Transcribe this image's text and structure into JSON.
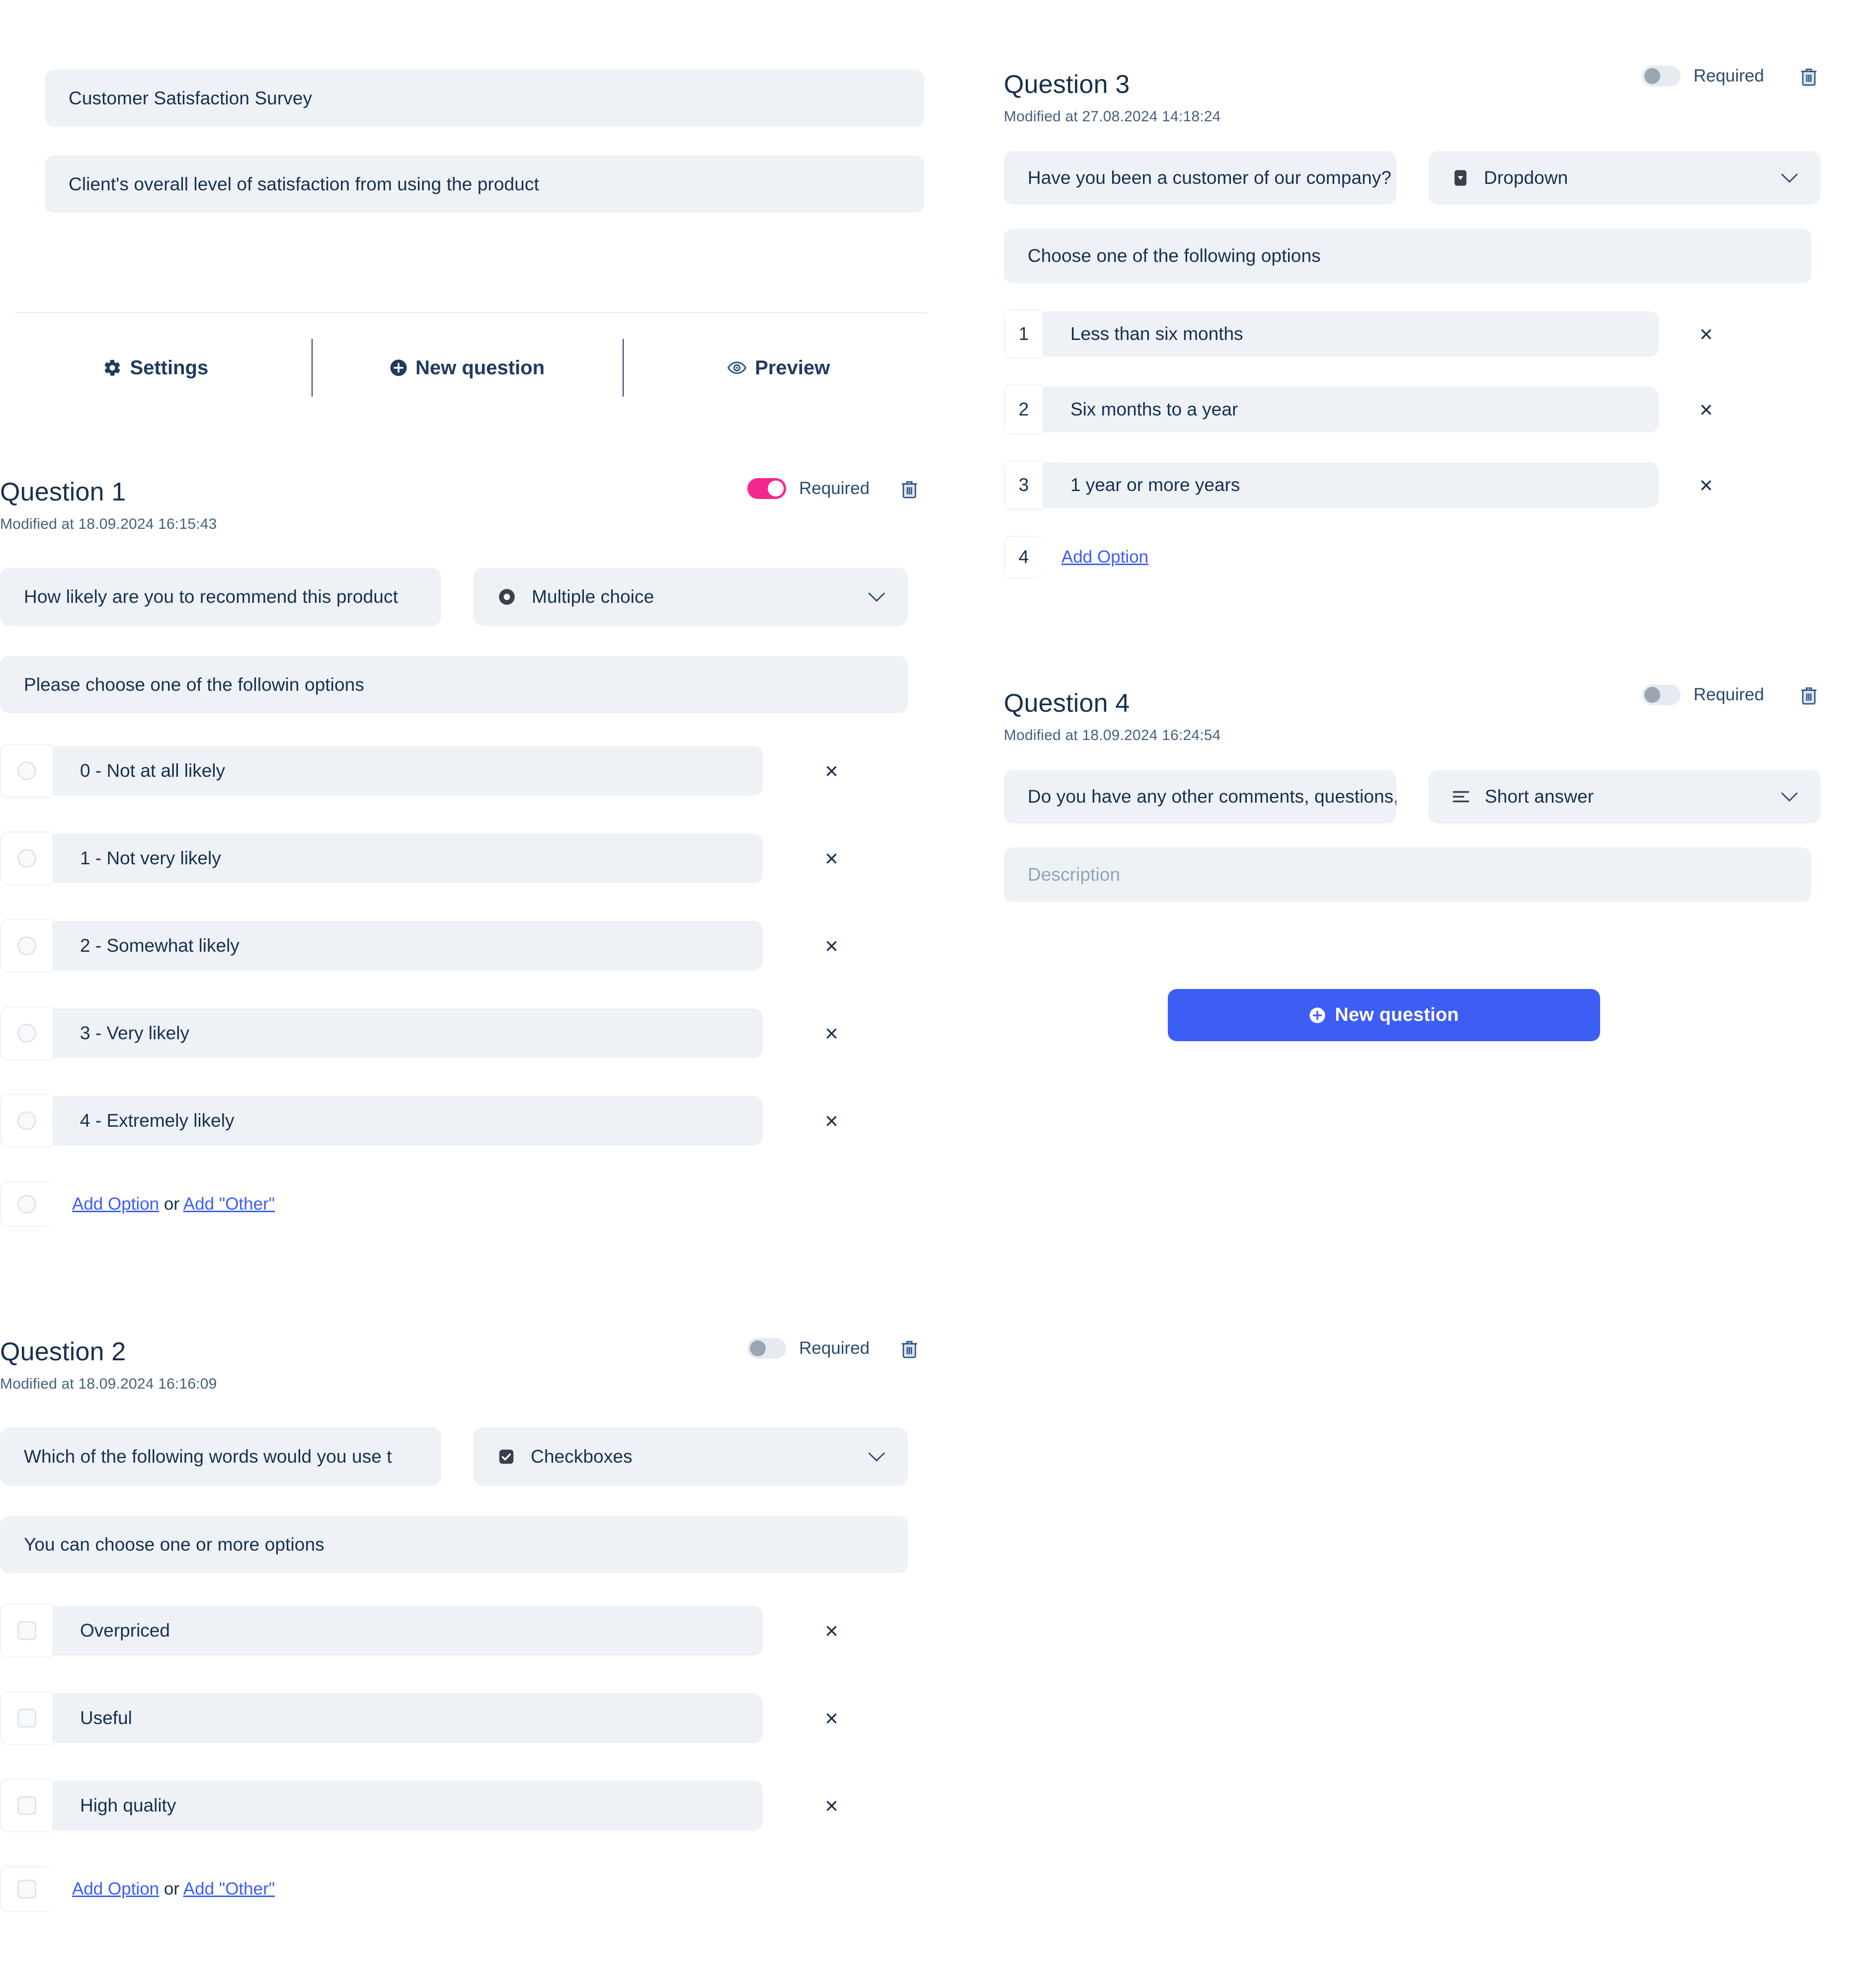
{
  "survey": {
    "title": "Customer Satisfaction Survey",
    "description": "Client's overall level of satisfaction from using the product"
  },
  "tabs": [
    {
      "label": "Settings",
      "icon": "gear-icon"
    },
    {
      "label": "New question",
      "icon": "plus-circle-icon"
    },
    {
      "label": "Preview",
      "icon": "eye-icon"
    }
  ],
  "labels": {
    "required": "Required",
    "add_option": "Add Option",
    "or": " or ",
    "add_other": "Add \"Other\"",
    "remove": "×",
    "new_question_button": "New question",
    "description_placeholder": "Description"
  },
  "colors": {
    "accent_blue": "#3d5ef5",
    "toggle_on_pink": "#f4278c",
    "field_bg": "#eef2f7",
    "text": "#16304f"
  },
  "questions": [
    {
      "title": "Question 1",
      "modified": "Modified at 18.09.2024 16:15:43",
      "required": true,
      "text": "How likely are you to recommend this product",
      "type": "Multiple choice",
      "type_icon": "radio-icon",
      "description": "Please choose one of the followin options",
      "option_marker": "radio",
      "options": [
        "0 - Not at all likely",
        "1 - Not very likely",
        "2 - Somewhat likely",
        "3 - Very likely",
        "4 - Extremely likely"
      ]
    },
    {
      "title": "Question 2",
      "modified": "Modified at 18.09.2024 16:16:09",
      "required": false,
      "text": "Which of the following words would you use t",
      "type": "Checkboxes",
      "type_icon": "checkbox-icon",
      "description": "You can choose one or more options",
      "option_marker": "checkbox",
      "options": [
        "Overpriced",
        "Useful",
        "High quality"
      ]
    },
    {
      "title": "Question 3",
      "modified": "Modified at 27.08.2024 14:18:24",
      "required": false,
      "text": "Have you been a customer of our company?",
      "type": "Dropdown",
      "type_icon": "dropdown-icon",
      "description": "Choose one of the following options",
      "option_marker": "number",
      "options": [
        "Less than six months",
        "Six months to a year",
        "1 year or more years"
      ],
      "option_numbers": [
        "1",
        "2",
        "3"
      ],
      "add_number": "4"
    },
    {
      "title": "Question 4",
      "modified": "Modified at 18.09.2024 16:24:54",
      "required": false,
      "text": "Do you have any other comments, questions,",
      "type": "Short answer",
      "type_icon": "lines-icon",
      "description": "",
      "option_marker": "none",
      "options": []
    }
  ]
}
